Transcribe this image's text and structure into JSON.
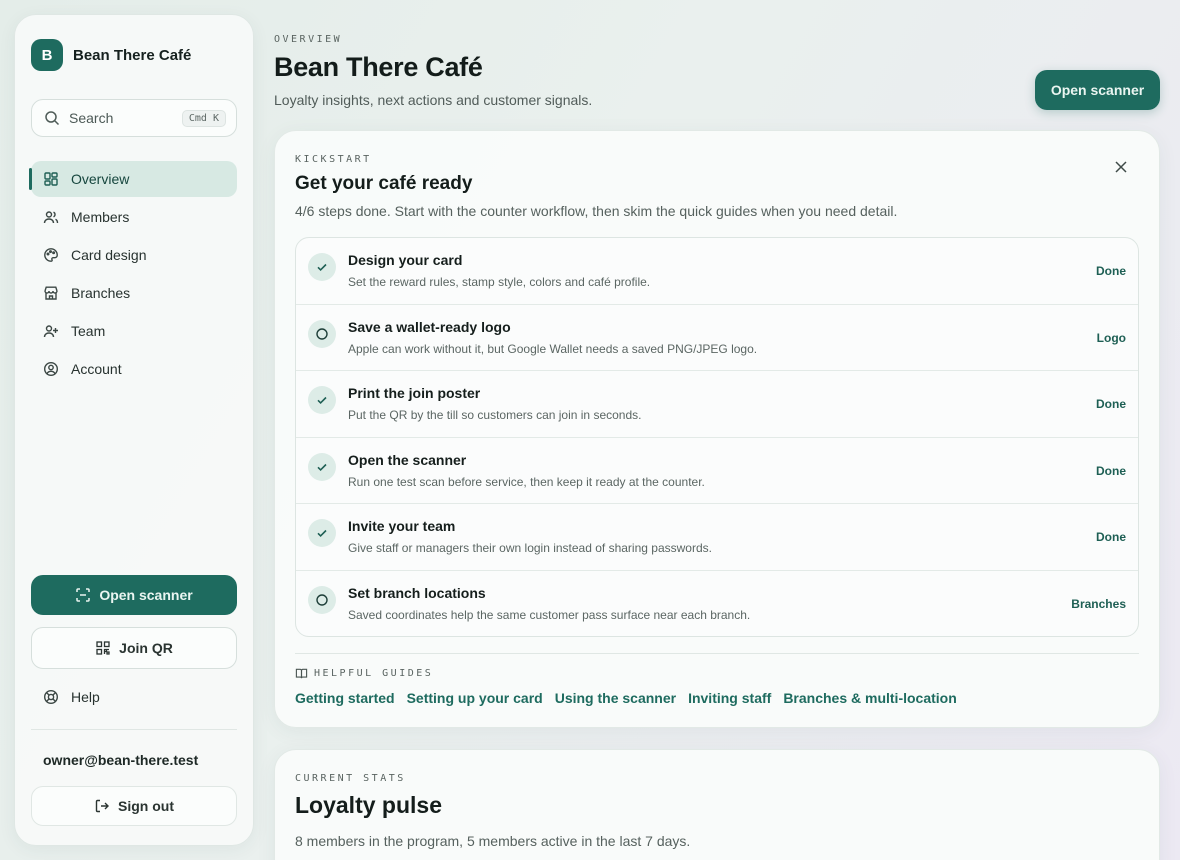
{
  "sidebar": {
    "brand_initial": "B",
    "brand_name": "Bean There Café",
    "search_placeholder": "Search",
    "search_shortcut": "Cmd K",
    "nav": [
      {
        "label": "Overview",
        "icon": "grid-icon",
        "active": true
      },
      {
        "label": "Members",
        "icon": "users-icon"
      },
      {
        "label": "Card design",
        "icon": "palette-icon"
      },
      {
        "label": "Branches",
        "icon": "store-icon"
      },
      {
        "label": "Team",
        "icon": "user-plus-icon"
      },
      {
        "label": "Account",
        "icon": "user-circle-icon"
      }
    ],
    "open_scanner": "Open scanner",
    "join_qr": "Join QR",
    "help": "Help",
    "email": "owner@bean-there.test",
    "sign_out": "Sign out"
  },
  "header": {
    "eyebrow": "OVERVIEW",
    "title": "Bean There Café",
    "subtitle": "Loyalty insights, next actions and customer signals.",
    "open_scanner": "Open scanner"
  },
  "kickstart": {
    "eyebrow": "KICKSTART",
    "title": "Get your café ready",
    "subtitle": "4/6 steps done. Start with the counter workflow, then skim the quick guides when you need detail.",
    "steps": [
      {
        "title": "Design your card",
        "desc": "Set the reward rules, stamp style, colors and café profile.",
        "action": "Done",
        "done": true
      },
      {
        "title": "Save a wallet-ready logo",
        "desc": "Apple can work without it, but Google Wallet needs a saved PNG/JPEG logo.",
        "action": "Logo",
        "done": false
      },
      {
        "title": "Print the join poster",
        "desc": "Put the QR by the till so customers can join in seconds.",
        "action": "Done",
        "done": true
      },
      {
        "title": "Open the scanner",
        "desc": "Run one test scan before service, then keep it ready at the counter.",
        "action": "Done",
        "done": true
      },
      {
        "title": "Invite your team",
        "desc": "Give staff or managers their own login instead of sharing passwords.",
        "action": "Done",
        "done": true
      },
      {
        "title": "Set branch locations",
        "desc": "Saved coordinates help the same customer pass surface near each branch.",
        "action": "Branches",
        "done": false
      }
    ],
    "guides_eyebrow": "HELPFUL GUIDES",
    "guides": [
      "Getting started",
      "Setting up your card",
      "Using the scanner",
      "Inviting staff",
      "Branches & multi-location"
    ]
  },
  "stats": {
    "eyebrow": "CURRENT STATS",
    "title": "Loyalty pulse",
    "subtitle": "8 members in the program, 5 members active in the last 7 days."
  }
}
